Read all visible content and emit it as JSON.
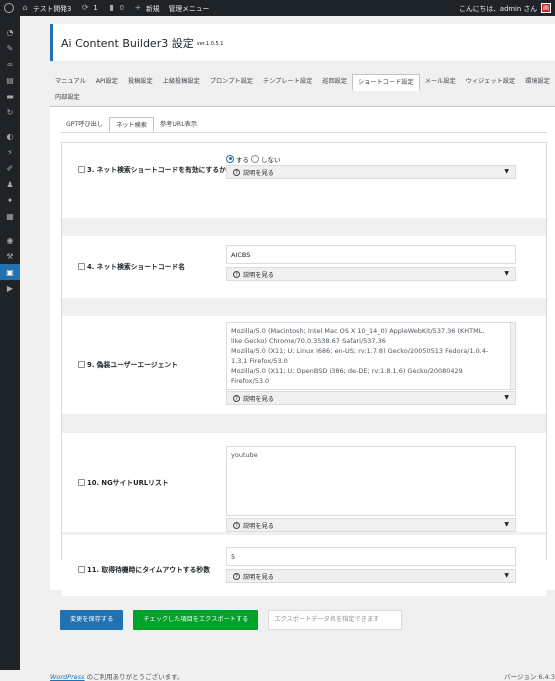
{
  "adminbar": {
    "site_name": "テスト開発3",
    "updates_count": "1",
    "comments_count": "0",
    "new_label": "新規",
    "admin_menu_label": "管理メニュー",
    "greeting": "こんにちは、admin さん"
  },
  "page": {
    "title": "Ai Content Builder3 設定",
    "version": "ver.1.0.5.1"
  },
  "tabs": [
    "マニュアル",
    "API設定",
    "投稿設定",
    "上級投稿設定",
    "プロンプト設定",
    "テンプレート設定",
    "巡回設定",
    "ショートコード設定",
    "メール設定",
    "ウィジェット設定",
    "環境設定",
    "内部設定"
  ],
  "active_tab": "ショートコード設定",
  "subtabs": [
    "GPT呼び出し",
    "ネット検索",
    "参考URL表示"
  ],
  "active_subtab": "ネット検索",
  "help_label": "説明を見る",
  "settings": {
    "s3": {
      "label": "3. ネット検索ショートコードを有効にするか",
      "radio_yes": "する",
      "radio_no": "しない",
      "selected": "する"
    },
    "s4": {
      "label": "4. ネット検索ショートコード名",
      "value": "AICBS"
    },
    "s9": {
      "label": "9. 偽装ユーザーエージェント",
      "lines": [
        "Mozilla/5.0 (Macintosh; Intel Mac OS X 10_14_0) AppleWebKit/537.36 (KHTML,",
        "like Gecko) Chrome/70.0.3538.67 Safari/537.36",
        "Mozilla/5.0 (X11; U; Linux i686; en-US; rv:1.7.8) Gecko/20050513 Fedora/1.0.4-",
        "1.3.1 Firefox/53.0",
        "Mozilla/5.0 (X11; U; OpenBSD i386; de-DE; rv:1.8.1.6) Gecko/20080429",
        "Firefox/53.0"
      ]
    },
    "s10": {
      "label": "10. NGサイトURLリスト",
      "value": "youtube"
    },
    "s11": {
      "label": "11. 取得待機時にタイムアウトする秒数",
      "value": "5"
    }
  },
  "buttons": {
    "save": "変更を保存する",
    "export": "チェックした項目をエクスポートする",
    "export_placeholder": "エクスポートデータ名を指定できます"
  },
  "footer": {
    "link": "WordPress",
    "thanks": " のご利用ありがとうございます。",
    "version": "バージョン 6.4.3"
  },
  "colors": {
    "accent": "#2271b1",
    "export_button": "#00a32a",
    "adminbar": "#1d2327"
  }
}
